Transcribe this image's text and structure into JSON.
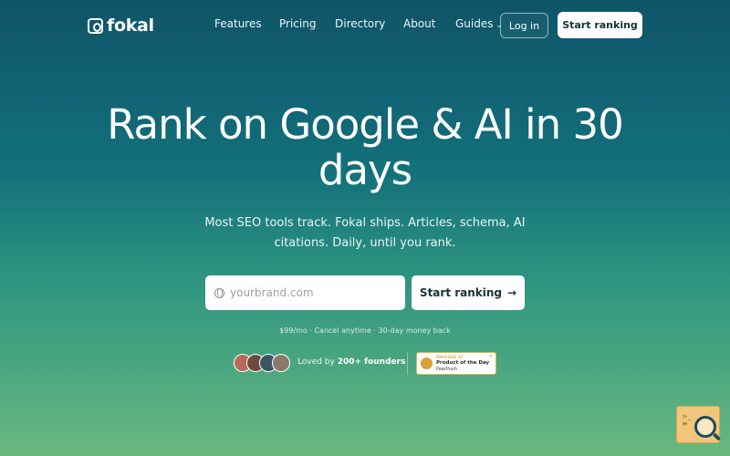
{
  "brand": {
    "name": "fokal",
    "icon": "fokal-logo-icon"
  },
  "nav": {
    "links": [
      {
        "label": "Features"
      },
      {
        "label": "Pricing"
      },
      {
        "label": "Directory"
      },
      {
        "label": "About"
      },
      {
        "label": "Guides",
        "icon": "chevron-down-icon"
      }
    ],
    "login_label": "Log in",
    "cta_label": "Start ranking"
  },
  "hero": {
    "title": "Rank on Google & AI in 30 days",
    "subtitle": "Most SEO tools track. Fokal ships. Articles, schema, AI citations. Daily, until you rank.",
    "input_placeholder": "yourbrand.com",
    "input_icon": "globe-icon",
    "cta_label": "Start ranking",
    "cta_icon": "arrow-right-icon",
    "fine_print": "$99/mo · Cancel anytime · 30-day money back"
  },
  "social_proof": {
    "avatars": [
      {
        "initials": "",
        "color": "#b96a5a"
      },
      {
        "initials": "",
        "color": "#6b4d3f"
      },
      {
        "initials": "",
        "color": "#3c5566"
      },
      {
        "initials": "",
        "color": "#8a7a6a"
      }
    ],
    "loved_prefix": "Loved by",
    "loved_count": "200+ founders"
  },
  "badge": {
    "small": "AWARDED AT",
    "title": "Product of the Day",
    "brand": "PeerPush"
  },
  "widget": {
    "icon": "search-assistant-icon"
  },
  "colors": {
    "accent": "#ffffff",
    "text_dark": "#16323a"
  }
}
